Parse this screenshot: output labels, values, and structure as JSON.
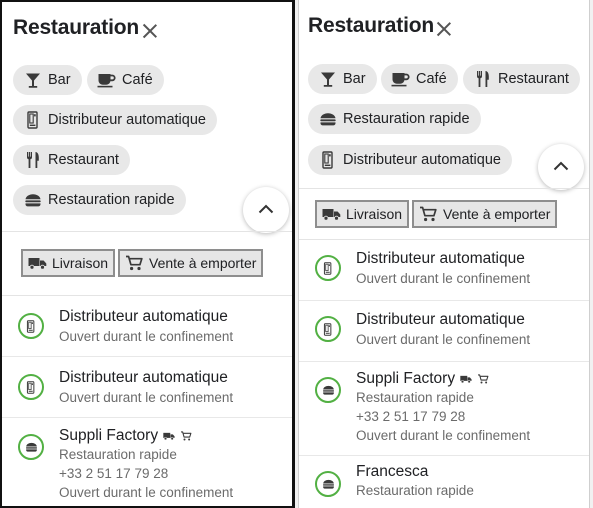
{
  "left": {
    "title": "Restauration",
    "chips": [
      {
        "label": "Bar",
        "icon": "bar-icon"
      },
      {
        "label": "Café",
        "icon": "coffee-cup-icon"
      },
      {
        "label": "Distributeur automatique",
        "icon": "vending-machine-icon"
      },
      {
        "label": "Restaurant",
        "icon": "fork-knife-icon"
      },
      {
        "label": "Restauration rapide",
        "icon": "burger-icon"
      }
    ],
    "filters": [
      {
        "label": "Livraison",
        "icon": "truck-icon"
      },
      {
        "label": "Vente à emporter",
        "icon": "cart-icon"
      }
    ],
    "results": [
      {
        "name": "Distributeur automatique",
        "lines": [
          "Ouvert durant le confinement"
        ],
        "icon": "vending-machine-icon"
      },
      {
        "name": "Distributeur automatique",
        "lines": [
          "Ouvert durant le confinement"
        ],
        "icon": "vending-machine-icon"
      },
      {
        "name": "Suppli Factory",
        "lines": [
          "Restauration rapide",
          "+33 2 51 17 79 28",
          "Ouvert durant le confinement"
        ],
        "icon": "burger-icon",
        "badges": [
          "truck-icon",
          "cart-icon"
        ]
      }
    ]
  },
  "right": {
    "title": "Restauration",
    "chips": [
      {
        "label": "Bar",
        "icon": "bar-icon"
      },
      {
        "label": "Café",
        "icon": "coffee-cup-icon"
      },
      {
        "label": "Restaurant",
        "icon": "fork-knife-icon"
      },
      {
        "label": "Restauration rapide",
        "icon": "burger-icon"
      },
      {
        "label": "Distributeur automatique",
        "icon": "vending-machine-icon"
      }
    ],
    "filters": [
      {
        "label": "Livraison",
        "icon": "truck-icon"
      },
      {
        "label": "Vente à emporter",
        "icon": "cart-icon"
      }
    ],
    "results": [
      {
        "name": "Distributeur automatique",
        "lines": [
          "Ouvert durant le confinement"
        ],
        "icon": "vending-machine-icon"
      },
      {
        "name": "Distributeur automatique",
        "lines": [
          "Ouvert durant le confinement"
        ],
        "icon": "vending-machine-icon"
      },
      {
        "name": "Suppli Factory",
        "lines": [
          "Restauration rapide",
          "+33 2 51 17 79 28",
          "Ouvert durant le confinement"
        ],
        "icon": "burger-icon",
        "badges": [
          "truck-icon",
          "cart-icon"
        ]
      },
      {
        "name": "Francesca",
        "lines": [
          "Restauration rapide"
        ],
        "icon": "burger-icon"
      }
    ]
  },
  "colors": {
    "accent_green": "#52b043",
    "chip_bg": "#e8e8e8",
    "text": "#202124",
    "muted": "#6b6b6b"
  }
}
